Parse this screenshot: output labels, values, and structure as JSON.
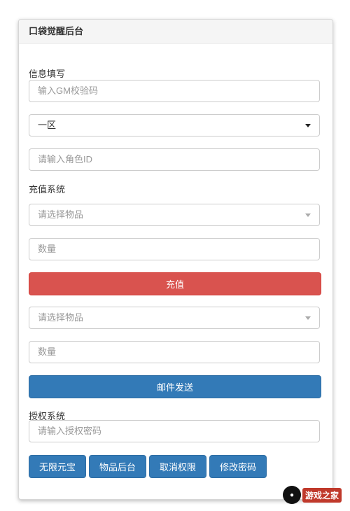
{
  "panel": {
    "title": "口袋觉醒后台"
  },
  "info": {
    "section_label": "信息填写",
    "gm_code_placeholder": "输入GM校验码",
    "server_selected": "一区",
    "role_id_placeholder": "请输入角色ID"
  },
  "recharge": {
    "section_label": "充值系统",
    "item_placeholder": "请选择物品",
    "quantity_placeholder": "数量",
    "recharge_button": "充值"
  },
  "mail": {
    "item_placeholder": "请选择物品",
    "quantity_placeholder": "数量",
    "send_button": "邮件发送"
  },
  "auth": {
    "section_label": "授权系统",
    "password_placeholder": "请输入授权密码",
    "buttons": [
      "无限元宝",
      "物品后台",
      "取消权限",
      "修改密码"
    ]
  },
  "watermark": {
    "text": "游戏之家"
  },
  "colors": {
    "danger": "#d9534f",
    "primary": "#337ab7"
  }
}
